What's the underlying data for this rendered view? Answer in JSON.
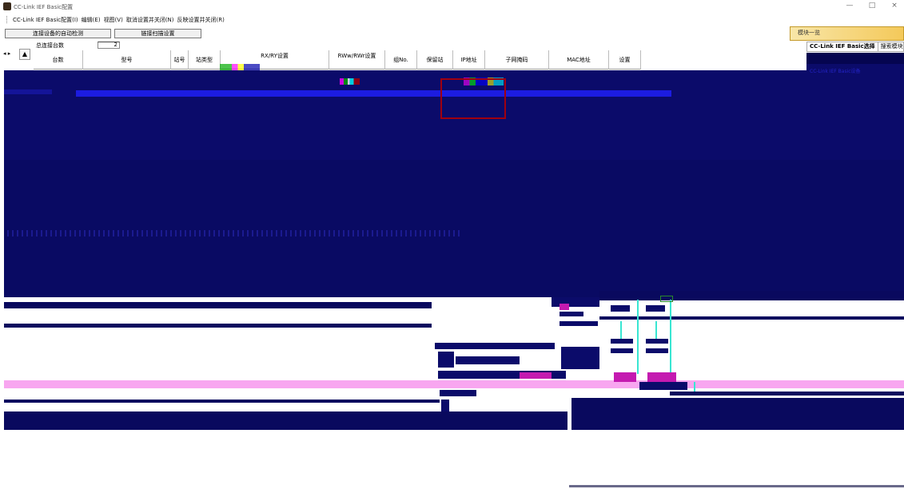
{
  "window": {
    "title": "CC-Link IEF Basic配置",
    "controls": [
      "—",
      "□",
      "×"
    ]
  },
  "menu": {
    "items": [
      "CC-Link IEF Basic配置(I)",
      "编辑(E)",
      "视图(V)",
      "取消设置并关闭(N)",
      "反映设置并关闭(R)"
    ]
  },
  "toolbar": {
    "auto_detect_label": "连接设备的自动检测",
    "scan_settings_label": "链接扫描设置"
  },
  "summary": {
    "total_label": "总连接台数",
    "total_value": "2"
  },
  "table": {
    "columns": [
      "台数",
      "型号",
      "站号",
      "站类型",
      "RX/RY设置",
      "RWw/RWr设置",
      "组No.",
      "保留站",
      "IP地址",
      "子网掩码",
      "MAC地址",
      "设置"
    ]
  },
  "side_panel": {
    "header": "模块一览",
    "tabs": [
      "CC-Link IEF Basic选择",
      "搜索模块",
      "("
    ],
    "items": [
      "CC-Link IEF Basic设备"
    ]
  },
  "colors": {
    "dark_fill": "#0b0b6a",
    "stripe_blue": "#1c1ce0",
    "pink": "#f8a6f0",
    "cyan": "#39e6d2",
    "red_box": "#a00010",
    "panel_header": "#f4c95a"
  }
}
